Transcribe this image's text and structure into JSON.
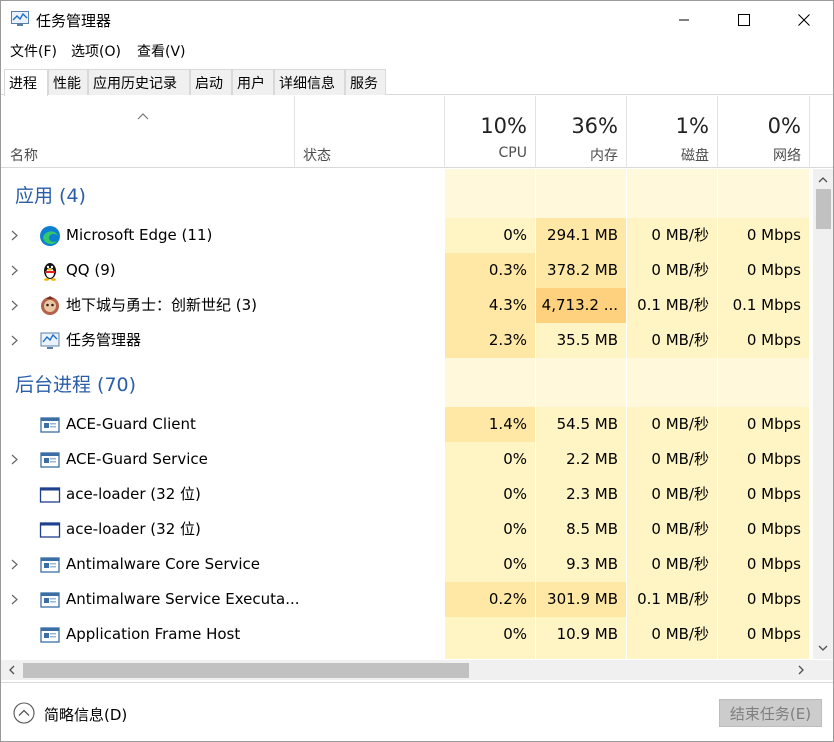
{
  "window": {
    "title": "任务管理器"
  },
  "menu": [
    {
      "label": "文件(F)"
    },
    {
      "label": "选项(O)"
    },
    {
      "label": "查看(V)"
    }
  ],
  "tabs": [
    {
      "label": "进程",
      "active": true
    },
    {
      "label": "性能"
    },
    {
      "label": "应用历史记录"
    },
    {
      "label": "启动"
    },
    {
      "label": "用户"
    },
    {
      "label": "详细信息"
    },
    {
      "label": "服务"
    }
  ],
  "columns": {
    "name": "名称",
    "status": "状态",
    "cpu": {
      "pct": "10%",
      "label": "CPU"
    },
    "mem": {
      "pct": "36%",
      "label": "内存"
    },
    "disk": {
      "pct": "1%",
      "label": "磁盘"
    },
    "net": {
      "pct": "0%",
      "label": "网络"
    }
  },
  "groups": {
    "apps": "应用 (4)",
    "background": "后台进程 (70)"
  },
  "rows": [
    {
      "name": "Microsoft Edge (11)",
      "cpu": "0%",
      "mem": "294.1 MB",
      "disk": "0 MB/秒",
      "net": "0 Mbps",
      "icon": "edge-icon",
      "expandable": true
    },
    {
      "name": "QQ (9)",
      "cpu": "0.3%",
      "mem": "378.2 MB",
      "disk": "0 MB/秒",
      "net": "0 Mbps",
      "icon": "qq-penguin-icon",
      "expandable": true
    },
    {
      "name": "地下城与勇士：创新世纪 (3)",
      "cpu": "4.3%",
      "mem": "4,713.2 ...",
      "disk": "0.1 MB/秒",
      "net": "0.1 Mbps",
      "icon": "game-icon",
      "expandable": true
    },
    {
      "name": "任务管理器",
      "cpu": "2.3%",
      "mem": "35.5 MB",
      "disk": "0 MB/秒",
      "net": "0 Mbps",
      "icon": "task-manager-icon",
      "expandable": true
    },
    {
      "name": "ACE-Guard Client",
      "cpu": "1.4%",
      "mem": "54.5 MB",
      "disk": "0 MB/秒",
      "net": "0 Mbps",
      "icon": "service-app-icon",
      "expandable": false
    },
    {
      "name": "ACE-Guard Service",
      "cpu": "0%",
      "mem": "2.2 MB",
      "disk": "0 MB/秒",
      "net": "0 Mbps",
      "icon": "service-app-icon",
      "expandable": true
    },
    {
      "name": "ace-loader (32 位)",
      "cpu": "0%",
      "mem": "2.3 MB",
      "disk": "0 MB/秒",
      "net": "0 Mbps",
      "icon": "window-app-icon",
      "expandable": false
    },
    {
      "name": "ace-loader (32 位)",
      "cpu": "0%",
      "mem": "8.5 MB",
      "disk": "0 MB/秒",
      "net": "0 Mbps",
      "icon": "window-app-icon",
      "expandable": false
    },
    {
      "name": "Antimalware Core Service",
      "cpu": "0%",
      "mem": "9.3 MB",
      "disk": "0 MB/秒",
      "net": "0 Mbps",
      "icon": "service-app-icon",
      "expandable": true
    },
    {
      "name": "Antimalware Service Executa...",
      "cpu": "0.2%",
      "mem": "301.9 MB",
      "disk": "0.1 MB/秒",
      "net": "0 Mbps",
      "icon": "service-app-icon",
      "expandable": true
    },
    {
      "name": "Application Frame Host",
      "cpu": "0%",
      "mem": "10.9 MB",
      "disk": "0 MB/秒",
      "net": "0 Mbps",
      "icon": "service-app-icon",
      "expandable": false
    }
  ],
  "footer": {
    "fewer_details": "简略信息(D)",
    "end_task": "结束任务(E)"
  },
  "colors": {
    "heat_light": "#fff4c4",
    "heat_mid": "#ffe8a6",
    "heat_high": "#fdd17d",
    "heat_empty": "#fff8da",
    "group_text": "#2a5ea8"
  }
}
